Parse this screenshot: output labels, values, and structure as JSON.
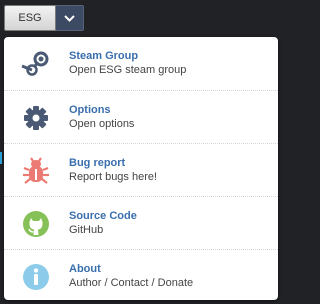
{
  "toolbar": {
    "app_button_label": "ESG",
    "dropdown_icon": "chevron-down-icon"
  },
  "menu": {
    "items": [
      {
        "title": "Steam Group",
        "subtitle": "Open ESG steam group",
        "icon": "steam-icon",
        "icon_color": "#4a5a74"
      },
      {
        "title": "Options",
        "subtitle": "Open options",
        "icon": "gear-icon",
        "icon_color": "#4a5a74"
      },
      {
        "title": "Bug report",
        "subtitle": "Report bugs here!",
        "icon": "bug-icon",
        "icon_color": "#ec7a74"
      },
      {
        "title": "Source Code",
        "subtitle": "GitHub",
        "icon": "github-icon",
        "icon_color": "#86c157"
      },
      {
        "title": "About",
        "subtitle": "Author / Contact / Donate",
        "icon": "info-icon",
        "icon_color": "#8ccbea"
      }
    ]
  },
  "colors": {
    "title_text": "#3a6fae",
    "subtitle_text": "#444444",
    "background": "#212226"
  }
}
